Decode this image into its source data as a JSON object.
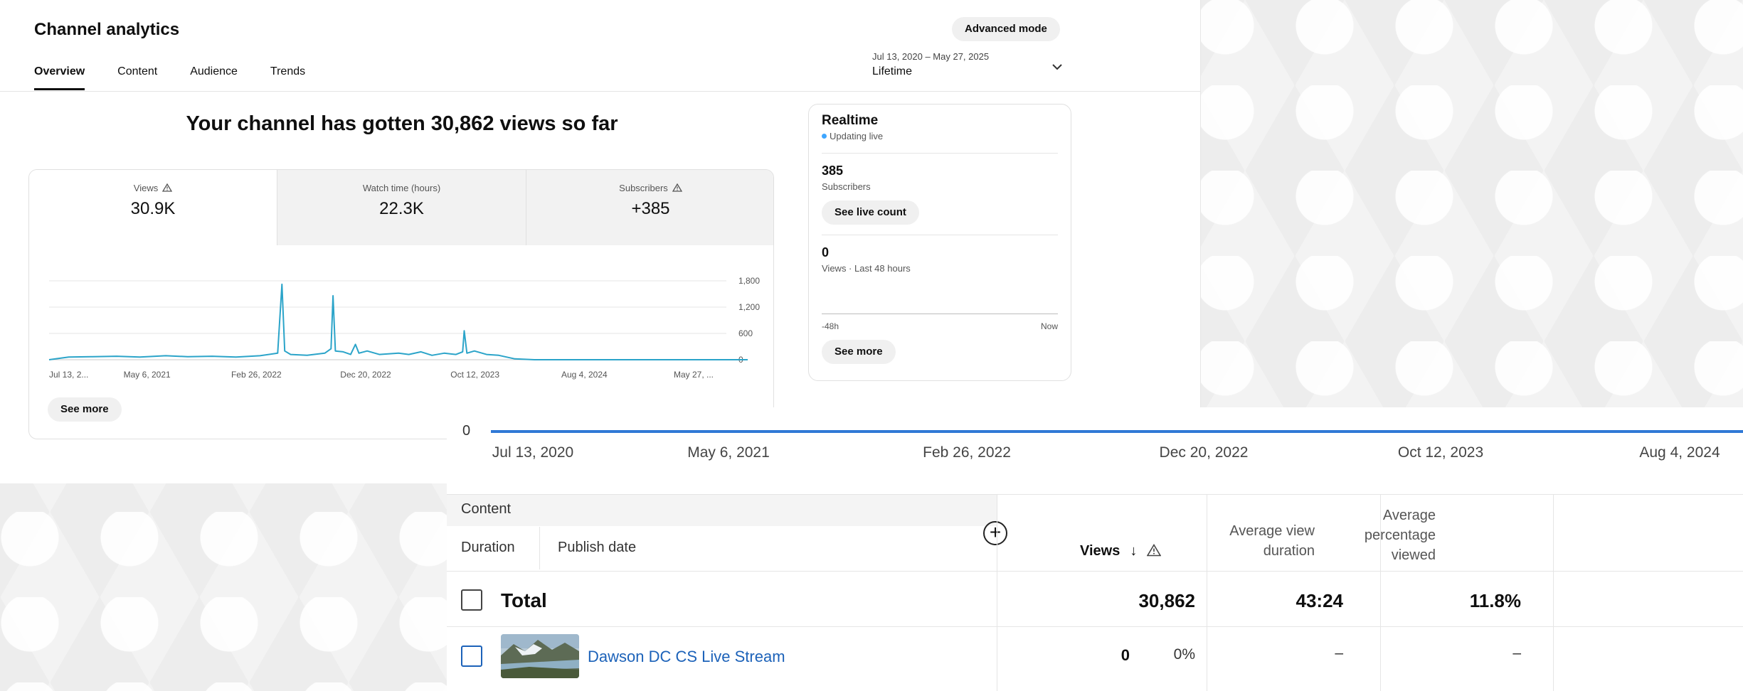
{
  "header": {
    "title": "Channel analytics",
    "advanced_mode": "Advanced mode",
    "tabs": [
      {
        "label": "Overview",
        "active": true
      },
      {
        "label": "Content",
        "active": false
      },
      {
        "label": "Audience",
        "active": false
      },
      {
        "label": "Trends",
        "active": false
      }
    ],
    "date_range": "Jul 13, 2020 – May 27, 2025",
    "date_label": "Lifetime"
  },
  "summary": {
    "headline": "Your channel has gotten 30,862 views so far",
    "metrics": [
      {
        "label": "Views",
        "value": "30.9K",
        "warning": true
      },
      {
        "label": "Watch time (hours)",
        "value": "22.3K",
        "warning": false
      },
      {
        "label": "Subscribers",
        "value": "+385",
        "warning": true
      }
    ],
    "see_more": "See more"
  },
  "chart_data": {
    "type": "line",
    "series": [
      {
        "x": [
          "2020-07-13",
          "2020-09-01",
          "2020-11-01",
          "2021-01-01",
          "2021-03-01",
          "2021-05-06",
          "2021-07-01",
          "2021-09-01",
          "2021-11-01",
          "2022-01-01",
          "2022-02-15",
          "2022-02-26",
          "2022-03-05",
          "2022-03-20",
          "2022-05-01",
          "2022-06-15",
          "2022-07-01",
          "2022-07-06",
          "2022-07-12",
          "2022-08-01",
          "2022-08-20",
          "2022-09-01",
          "2022-09-10",
          "2022-10-01",
          "2022-11-01",
          "2022-12-20",
          "2023-01-15",
          "2023-02-15",
          "2023-03-15",
          "2023-04-15",
          "2023-05-15",
          "2023-06-01",
          "2023-06-05",
          "2023-06-12",
          "2023-07-01",
          "2023-08-01",
          "2023-09-01",
          "2023-10-12",
          "2023-12-01",
          "2024-03-01",
          "2024-08-04",
          "2024-12-01",
          "2025-05-27"
        ],
        "y": [
          0,
          60,
          70,
          80,
          60,
          90,
          70,
          80,
          60,
          90,
          150,
          1720,
          200,
          120,
          100,
          150,
          250,
          1460,
          200,
          180,
          120,
          350,
          150,
          200,
          120,
          150,
          120,
          180,
          100,
          150,
          120,
          180,
          660,
          150,
          200,
          120,
          100,
          20,
          0,
          0,
          0,
          0,
          0
        ]
      }
    ],
    "y_ticks": [
      "1,800",
      "1,200",
      "600",
      "0"
    ],
    "ylim": [
      0,
      1800
    ],
    "x_ticks": [
      "Jul 13, 2...",
      "May 6, 2021",
      "Feb 26, 2022",
      "Dec 20, 2022",
      "Oct 12, 2023",
      "Aug 4, 2024",
      "May 27, ..."
    ],
    "grid": true,
    "color": "#2ba4c9"
  },
  "realtime": {
    "title": "Realtime",
    "status": "Updating live",
    "subscribers_value": "385",
    "subscribers_label": "Subscribers",
    "see_live_count": "See live count",
    "views_value": "0",
    "views_label": "Views · Last 48 hours",
    "axis_start": "-48h",
    "axis_end": "Now",
    "see_more": "See more"
  },
  "overlay": {
    "zero_label": "0",
    "axis": [
      "Jul 13, 2020",
      "May 6, 2021",
      "Feb 26, 2022",
      "Dec 20, 2022",
      "Oct 12, 2023",
      "Aug 4, 2024"
    ],
    "table": {
      "content_header": "Content",
      "duration_header": "Duration",
      "publish_header": "Publish date",
      "views_header": "Views",
      "sort_arrow": "↓",
      "avg_view_duration_header": "Average view duration",
      "avg_pct_header": "Average percentage viewed",
      "total": {
        "label": "Total",
        "views": "30,862",
        "avd": "43:24",
        "apv": "11.8%"
      },
      "rows": [
        {
          "title": "Dawson DC CS Live Stream",
          "views": "0",
          "views_pct": "0%",
          "avd": "–",
          "apv": "–"
        }
      ]
    }
  },
  "colors": {
    "accent": "#3ea6ff",
    "link": "#1c62b9",
    "line": "#2ba4c9",
    "overlay_line": "#3079d6"
  }
}
